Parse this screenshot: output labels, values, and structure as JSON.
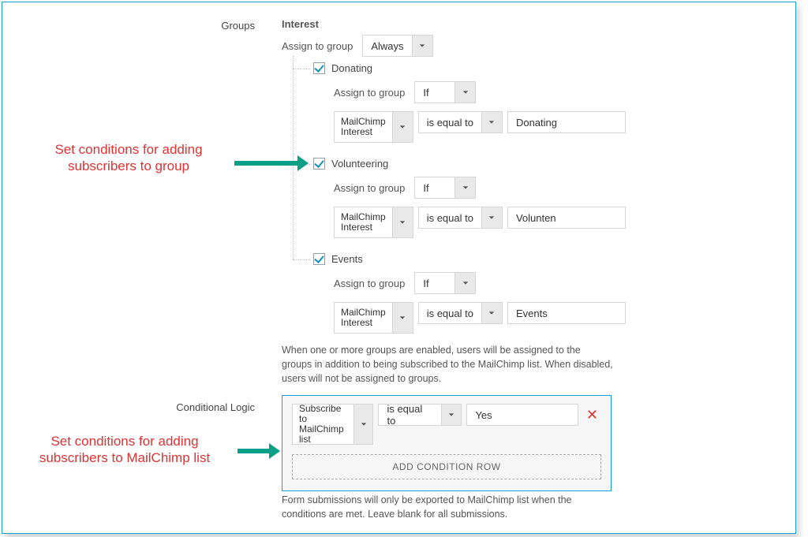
{
  "labels": {
    "groups": "Groups",
    "conditional_logic": "Conditional Logic"
  },
  "annotations": {
    "group_line1": "Set conditions for adding",
    "group_line2": "subscribers to group",
    "list_line1": "Set conditions for adding",
    "list_line2": "subscribers to MailChimp list"
  },
  "interest_title": "Interest",
  "assign_to_group": "Assign to group",
  "top_assign_value": "Always",
  "groups": {
    "donating": {
      "label": "Donating",
      "assign_value": "If",
      "field_line1": "MailChimp",
      "field_line2": "Interest",
      "op": "is equal to",
      "value": "Donating"
    },
    "volunteer": {
      "label": "Volunteering",
      "assign_value": "If",
      "field_line1": "MailChimp",
      "field_line2": "Interest",
      "op": "is equal to",
      "value": "Volunten"
    },
    "events": {
      "label": "Events",
      "assign_value": "If",
      "field_line1": "MailChimp",
      "field_line2": "Interest",
      "op": "is equal to",
      "value": "Events"
    }
  },
  "groups_desc": "When one or more groups are enabled, users will be assigned to the groups in addition to being subscribed to the MailChimp list. When disabled, users will not be assigned to groups.",
  "cond": {
    "field_line1": "Subscribe to",
    "field_line2": "MailChimp",
    "field_line3": "list",
    "op": "is equal to",
    "value": "Yes",
    "add_row": "ADD CONDITION ROW"
  },
  "cond_desc": "Form submissions will only be exported to MailChimp list when the conditions are met. Leave blank for all submissions."
}
